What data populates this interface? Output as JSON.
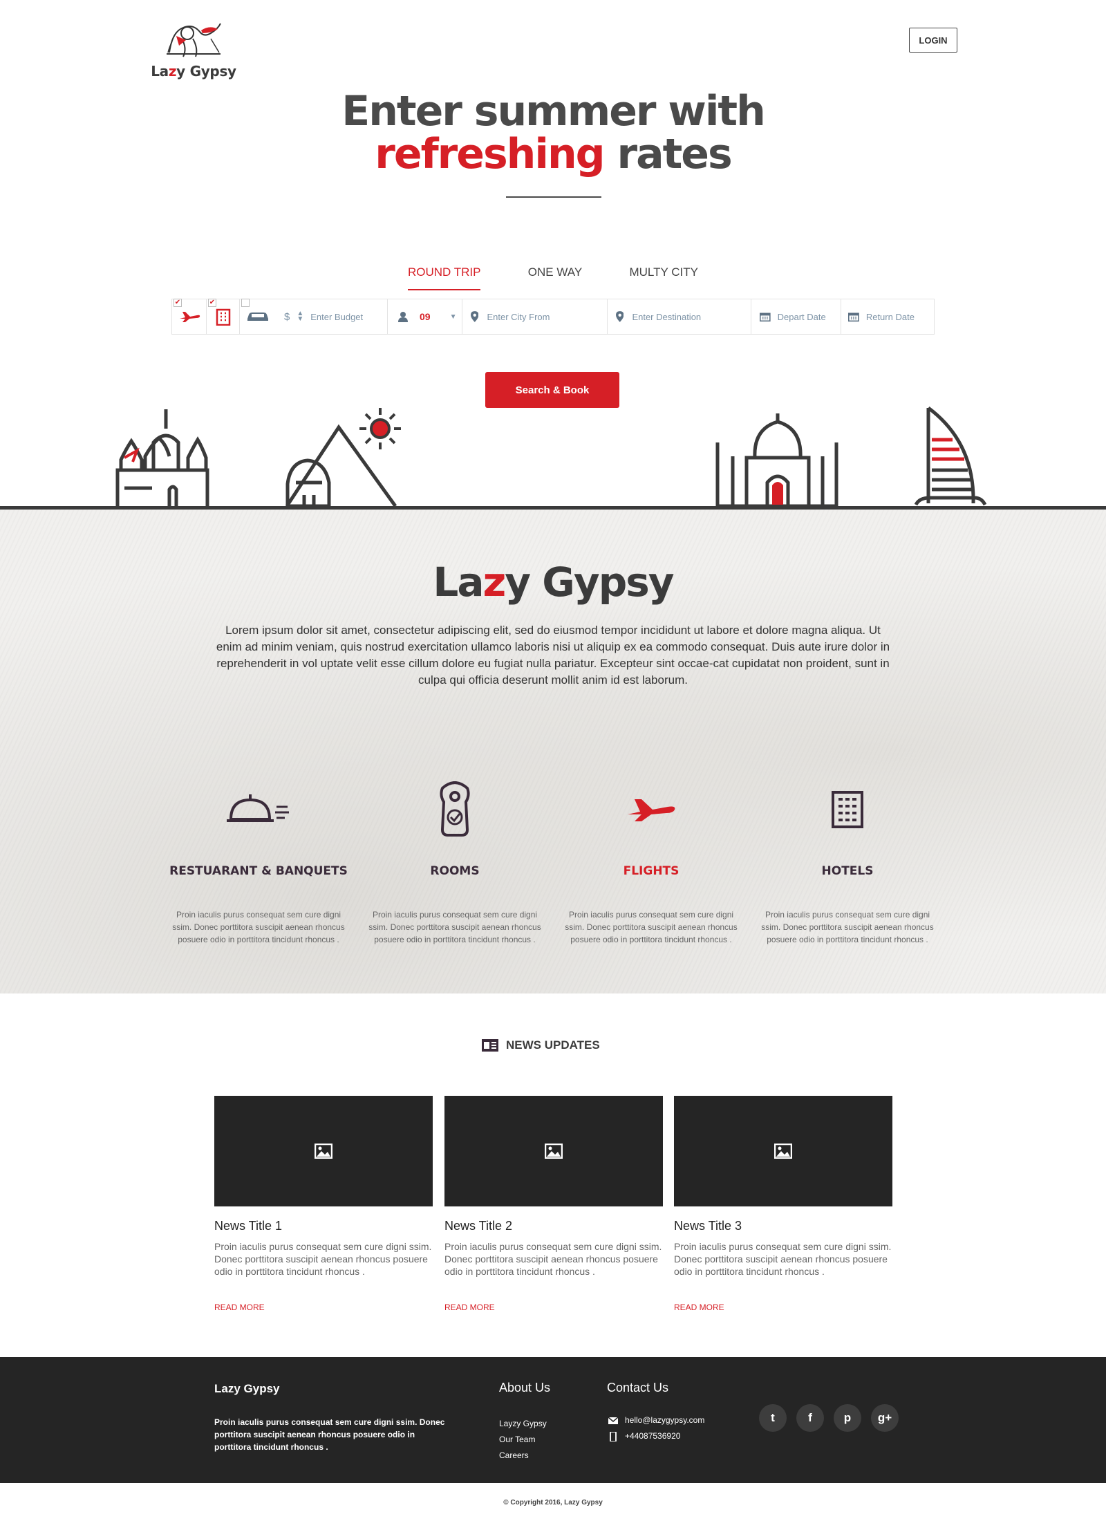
{
  "header": {
    "logo_text_pre": "La",
    "logo_text_z": "z",
    "logo_text_post": "y Gypsy",
    "login_label": "LOGIN"
  },
  "hero": {
    "line1": "Enter summer with",
    "line2_red": "refreshing",
    "line2_rest": "rates"
  },
  "tabs": [
    {
      "label": "ROUND TRIP",
      "active": true
    },
    {
      "label": "ONE WAY",
      "active": false
    },
    {
      "label": "MULTY CITY",
      "active": false
    }
  ],
  "search": {
    "flight_checked": true,
    "hotel_checked": true,
    "car_checked": false,
    "currency_symbol": "$",
    "budget_placeholder": "Enter Budget",
    "passengers_value": "09",
    "from_placeholder": "Enter City From",
    "destination_placeholder": "Enter Destination",
    "depart_placeholder": "Depart Date",
    "return_placeholder": "Return Date",
    "button_label": "Search & Book"
  },
  "about": {
    "title_pre": "La",
    "title_z": "z",
    "title_post": "y Gypsy",
    "body": "Lorem ipsum dolor sit amet, consectetur adipiscing elit, sed do eiusmod tempor incididunt ut labore et dolore magna aliqua. Ut enim ad minim veniam, quis nostrud exercitation ullamco laboris nisi ut aliquip ex ea commodo consequat. Duis aute irure dolor in reprehenderit in vol uptate velit esse cillum dolore eu fugiat nulla pariatur. Excepteur sint occae-cat cupidatat non proident, sunt in culpa qui officia deserunt mollit anim id est laborum."
  },
  "features": [
    {
      "title": "RESTUARANT & BANQUETS",
      "desc": "Proin iaculis purus consequat sem cure digni ssim. Donec porttitora  suscipit aenean rhoncus posuere odio in porttitora tincidunt rhoncus .",
      "icon": "cloche-icon"
    },
    {
      "title": "ROOMS",
      "desc": "Proin iaculis purus consequat sem cure digni ssim. Donec porttitora  suscipit aenean rhoncus posuere odio in porttitora tincidunt rhoncus .",
      "icon": "door-hanger-icon"
    },
    {
      "title": "FLIGHTS",
      "desc": "Proin iaculis purus consequat sem cure digni ssim. Donec porttitora  suscipit aenean rhoncus posuere odio in porttitora tincidunt rhoncus .",
      "icon": "airplane-icon"
    },
    {
      "title": "HOTELS",
      "desc": "Proin iaculis purus consequat sem cure digni ssim. Donec porttitora  suscipit aenean rhoncus posuere odio in porttitora tincidunt rhoncus .",
      "icon": "building-icon"
    }
  ],
  "news": {
    "heading": "NEWS UPDATES",
    "items": [
      {
        "title": "News Title 1",
        "body": "Proin iaculis purus consequat sem cure digni ssim. Donec porttitora  suscipit aenean rhoncus posuere odio in porttitora  tincidunt rhoncus .",
        "link": "READ MORE"
      },
      {
        "title": "News Title 2",
        "body": "Proin iaculis purus consequat sem cure digni ssim. Donec porttitora  suscipit aenean rhoncus posuere odio in porttitora  tincidunt rhoncus .",
        "link": "READ MORE"
      },
      {
        "title": "News Title 3",
        "body": "Proin iaculis purus consequat sem cure digni ssim. Donec porttitora  suscipit aenean rhoncus posuere odio in porttitora  tincidunt rhoncus .",
        "link": "READ MORE"
      }
    ]
  },
  "footer": {
    "brand": "Lazy Gypsy",
    "desc": "Proin iaculis purus consequat sem cure digni ssim. Donec porttitora  suscipit aenean rhoncus posuere odio in porttitora  tincidunt rhoncus .",
    "about_heading": "About Us",
    "about_links": [
      "Layzy Gypsy",
      "Our Team",
      "Careers"
    ],
    "contact_heading": "Contact Us",
    "email": "hello@lazygypsy.com",
    "phone": "+44087536920",
    "socials": [
      {
        "name": "twitter-icon",
        "glyph": "t"
      },
      {
        "name": "facebook-icon",
        "glyph": "f"
      },
      {
        "name": "pinterest-icon",
        "glyph": "p"
      },
      {
        "name": "google-plus-icon",
        "glyph": "g+"
      }
    ],
    "copyright": "© Copyright 2016, Lazy Gypsy"
  },
  "colors": {
    "accent": "#d61f26",
    "dark": "#252525",
    "text": "#4a4a4a"
  }
}
